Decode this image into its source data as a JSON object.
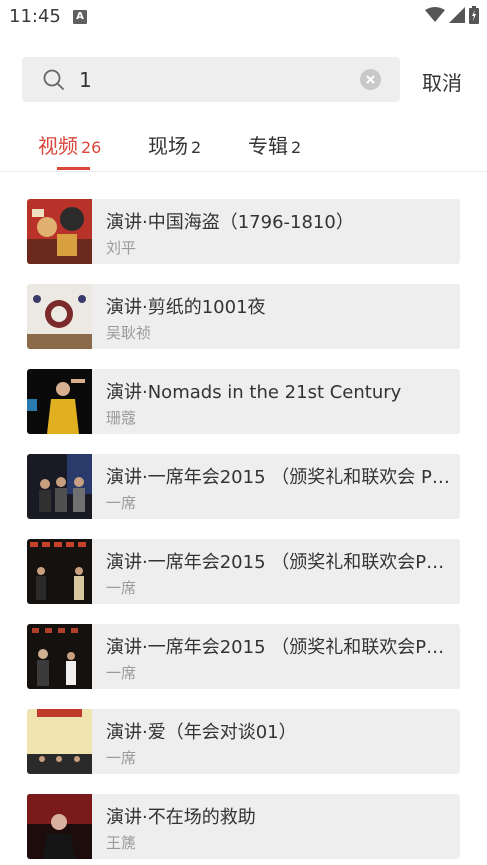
{
  "status_bar": {
    "time": "11:45",
    "notification_icon": "A"
  },
  "search": {
    "value": "1",
    "cancel_label": "取消"
  },
  "tabs": [
    {
      "label": "视频",
      "count": "26",
      "active": true
    },
    {
      "label": "现场",
      "count": "2",
      "active": false
    },
    {
      "label": "专辑",
      "count": "2",
      "active": false
    }
  ],
  "results": [
    {
      "title": "演讲·中国海盗（1796-1810）",
      "author": "刘平"
    },
    {
      "title": "演讲·剪纸的1001夜",
      "author": "吴耿祯"
    },
    {
      "title": "演讲·Nomads in the 21st Century",
      "author": "珊蔻"
    },
    {
      "title": "演讲·一席年会2015 （颁奖礼和联欢会 P…",
      "author": "一席"
    },
    {
      "title": "演讲·一席年会2015 （颁奖礼和联欢会P2…",
      "author": "一席"
    },
    {
      "title": "演讲·一席年会2015 （颁奖礼和联欢会P3…",
      "author": "一席"
    },
    {
      "title": "演讲·爱（年会对谈01）",
      "author": "一席"
    },
    {
      "title": "演讲·不在场的救助",
      "author": "王篪"
    }
  ],
  "colors": {
    "accent": "#d9473a",
    "card_bg": "#eeeeee",
    "muted_text": "#9b9b9b"
  },
  "icons": [
    "search-icon",
    "clear-icon",
    "wifi-icon",
    "signal-icon",
    "battery-icon"
  ]
}
